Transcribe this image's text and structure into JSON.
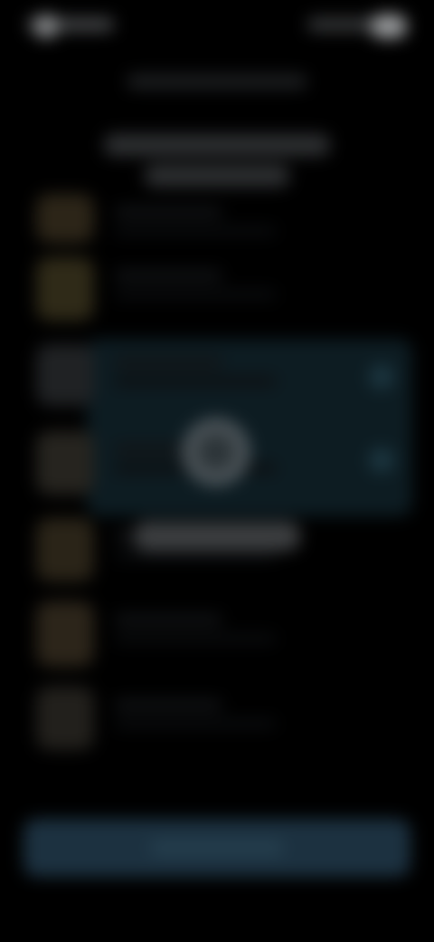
{
  "colors": {
    "background": "#000000",
    "card_selected": "#0d1c22",
    "button": "#1c3140",
    "thumb_warm": "#2c2518",
    "thumb_neutral": "#242220"
  },
  "status_bar": {
    "time": "",
    "icons": [
      "signal-icon",
      "wifi-icon",
      "battery-icon"
    ]
  },
  "header": {
    "subtitle": "",
    "title": ""
  },
  "list": {
    "items": [
      {
        "title": "",
        "subtitle": "",
        "selected": false
      },
      {
        "title": "",
        "subtitle": "",
        "selected": false
      },
      {
        "title": "",
        "subtitle": "",
        "selected": true
      },
      {
        "title": "",
        "subtitle": "",
        "selected": true
      },
      {
        "title": "",
        "subtitle": "",
        "selected": false
      },
      {
        "title": "",
        "subtitle": "",
        "selected": false
      },
      {
        "title": "",
        "subtitle": "",
        "selected": false
      }
    ]
  },
  "center": {
    "icon": "ring-icon",
    "label": ""
  },
  "footer": {
    "button_label": ""
  }
}
